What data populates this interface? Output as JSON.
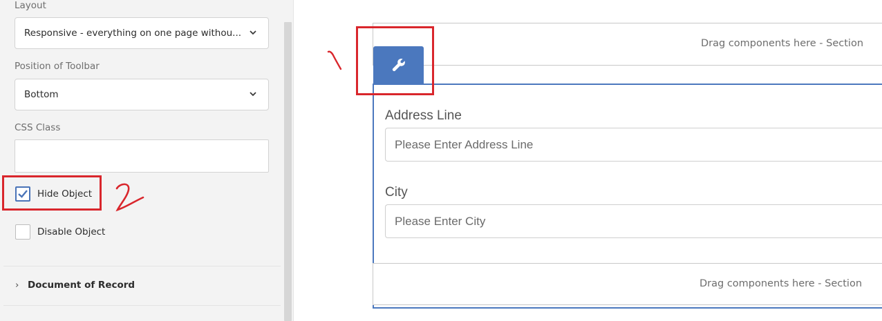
{
  "properties": {
    "layout": {
      "label": "Layout",
      "value": "Responsive - everything on one page withou..."
    },
    "toolbar_position": {
      "label": "Position of Toolbar",
      "value": "Bottom"
    },
    "css_class": {
      "label": "CSS Class",
      "value": ""
    },
    "hide_object": {
      "label": "Hide Object",
      "checked": true
    },
    "disable_object": {
      "label": "Disable Object",
      "checked": false
    },
    "document_of_record": {
      "label": "Document of Record",
      "expanded": false
    }
  },
  "canvas": {
    "top_section_text": "Drag components here - Section",
    "bottom_section_text": "Drag components here - Section",
    "tool_tab_icon": "wrench-icon",
    "fields": [
      {
        "label": "Address Line",
        "placeholder": "Please Enter Address Line"
      },
      {
        "label": "City",
        "placeholder": "Please Enter City"
      }
    ]
  },
  "annotations": {
    "mark_1": "1",
    "mark_2": "2",
    "color": "#d9262c"
  },
  "colors": {
    "accent": "#4b78be",
    "checkbox_accent": "#4a74b8",
    "panel_bg": "#f3f3f3"
  }
}
